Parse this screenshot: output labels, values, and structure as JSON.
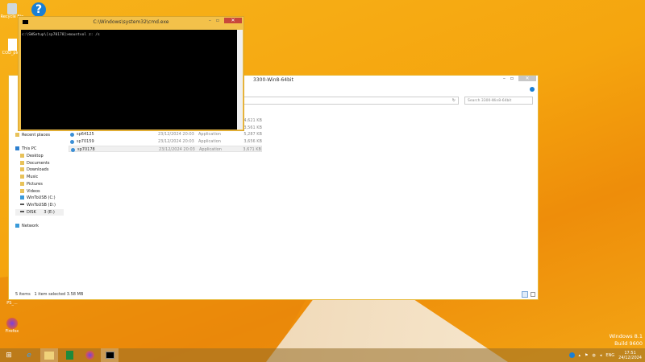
{
  "desktop": {
    "icons": [
      "Recycle Bin",
      "",
      "COD_pldd",
      "",
      "",
      "",
      "",
      "",
      "PS_..."
    ],
    "firefox_label": "Firefox",
    "watermark": [
      "Windows 8.1",
      "Build 9600"
    ]
  },
  "explorer": {
    "title": "3300-Win8-64bit",
    "search_placeholder": "Search 3300-Win8-64bit",
    "nav": [
      {
        "label": "Recent places"
      },
      {
        "label": ""
      },
      {
        "label": "This PC"
      },
      {
        "label": "Desktop"
      },
      {
        "label": "Documents"
      },
      {
        "label": "Downloads"
      },
      {
        "label": "Music"
      },
      {
        "label": "Pictures"
      },
      {
        "label": "Videos"
      },
      {
        "label": "WinToUSB (C:)"
      },
      {
        "label": "WinToUSB (D:)"
      },
      {
        "label": "DISK      3 (E:)"
      },
      {
        "label": ""
      },
      {
        "label": "Network"
      }
    ],
    "files": [
      {
        "name": "",
        "date": "",
        "type": "",
        "size": "4,621 KB"
      },
      {
        "name": "",
        "date": "",
        "type": "",
        "size": "3,561 KB"
      },
      {
        "name": "sp64125",
        "date": "23/12/2024 20:03",
        "type": "Application",
        "size": "5,287 KB"
      },
      {
        "name": "sp70159",
        "date": "23/12/2024 20:03",
        "type": "Application",
        "size": "3,656 KB"
      },
      {
        "name": "sp70178",
        "date": "23/12/2024 20:03",
        "type": "Application",
        "size": "3,671 KB"
      }
    ],
    "status": {
      "items": "5 items",
      "selected": "1 item selected  3.58 MB"
    }
  },
  "cmd": {
    "title": "C:\\Windows\\system32\\cmd.exe",
    "line": "c:\\SWSetup\\[sp70178]>mountvol z: /s"
  },
  "tray": {
    "lang": "ENG",
    "time": "17:51",
    "date": "24/12/2024"
  }
}
